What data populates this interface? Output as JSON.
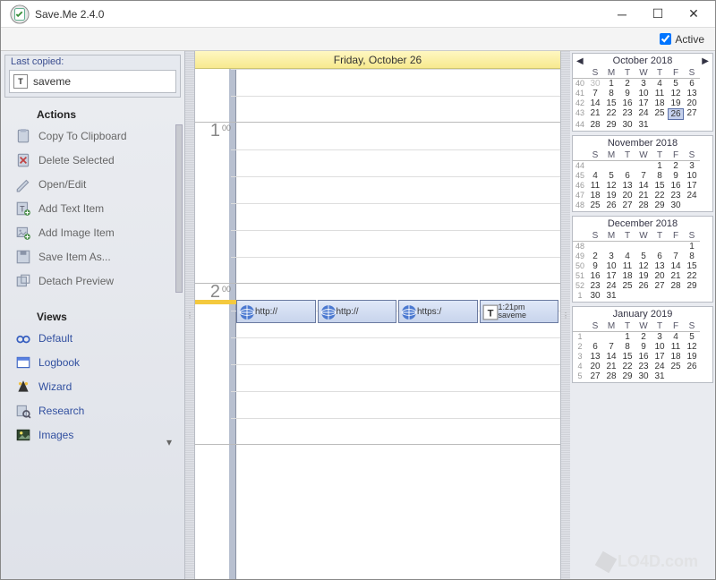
{
  "window": {
    "title": "Save.Me 2.4.0"
  },
  "toolbar": {
    "active_label": "Active",
    "active_checked": true
  },
  "last_copied": {
    "heading": "Last copied:",
    "item_label": "saveme"
  },
  "actions": {
    "heading": "Actions",
    "items": [
      {
        "label": "Copy To Clipboard",
        "icon": "clipboard-icon"
      },
      {
        "label": "Delete Selected",
        "icon": "delete-icon"
      },
      {
        "label": "Open/Edit",
        "icon": "edit-icon"
      },
      {
        "label": "Add Text Item",
        "icon": "text-add-icon"
      },
      {
        "label": "Add Image Item",
        "icon": "image-add-icon"
      },
      {
        "label": "Save Item As...",
        "icon": "save-as-icon"
      },
      {
        "label": "Detach Preview",
        "icon": "detach-icon"
      }
    ]
  },
  "views": {
    "heading": "Views",
    "items": [
      {
        "label": "Default",
        "icon": "glasses-icon"
      },
      {
        "label": "Logbook",
        "icon": "logbook-icon"
      },
      {
        "label": "Wizard",
        "icon": "wizard-icon"
      },
      {
        "label": "Research",
        "icon": "research-icon"
      },
      {
        "label": "Images",
        "icon": "images-icon"
      }
    ]
  },
  "day_view": {
    "header": "Friday, October 26",
    "hours": [
      {
        "label": "",
        "min": ""
      },
      {
        "label": "1",
        "min": "00"
      },
      {
        "label": "2",
        "min": "00"
      }
    ],
    "events": [
      {
        "icon": "globe-icon",
        "text": "http://"
      },
      {
        "icon": "globe-icon",
        "text": "http://"
      },
      {
        "icon": "globe-icon",
        "text": "https:/"
      },
      {
        "icon": "text-icon",
        "text": "1:21pm",
        "note": "saveme"
      }
    ]
  },
  "calendars": [
    {
      "title": "October 2018",
      "nav": true,
      "dow": [
        "S",
        "M",
        "T",
        "W",
        "T",
        "F",
        "S"
      ],
      "weeks": [
        {
          "wn": 40,
          "days": [
            {
              "n": 30,
              "out": true
            },
            {
              "n": 1
            },
            {
              "n": 2
            },
            {
              "n": 3
            },
            {
              "n": 4
            },
            {
              "n": 5
            },
            {
              "n": 6
            }
          ]
        },
        {
          "wn": 41,
          "days": [
            {
              "n": 7
            },
            {
              "n": 8
            },
            {
              "n": 9
            },
            {
              "n": 10
            },
            {
              "n": 11
            },
            {
              "n": 12
            },
            {
              "n": 13
            }
          ]
        },
        {
          "wn": 42,
          "days": [
            {
              "n": 14
            },
            {
              "n": 15
            },
            {
              "n": 16
            },
            {
              "n": 17
            },
            {
              "n": 18
            },
            {
              "n": 19
            },
            {
              "n": 20
            }
          ]
        },
        {
          "wn": 43,
          "days": [
            {
              "n": 21
            },
            {
              "n": 22
            },
            {
              "n": 23
            },
            {
              "n": 24
            },
            {
              "n": 25
            },
            {
              "n": 26,
              "sel": true
            },
            {
              "n": 27
            }
          ]
        },
        {
          "wn": 44,
          "days": [
            {
              "n": 28
            },
            {
              "n": 29
            },
            {
              "n": 30
            },
            {
              "n": 31
            },
            {
              "n": ""
            },
            {
              "n": ""
            },
            {
              "n": ""
            }
          ]
        }
      ]
    },
    {
      "title": "November 2018",
      "dow": [
        "S",
        "M",
        "T",
        "W",
        "T",
        "F",
        "S"
      ],
      "weeks": [
        {
          "wn": 44,
          "days": [
            {
              "n": ""
            },
            {
              "n": ""
            },
            {
              "n": ""
            },
            {
              "n": ""
            },
            {
              "n": 1
            },
            {
              "n": 2
            },
            {
              "n": 3
            }
          ]
        },
        {
          "wn": 45,
          "days": [
            {
              "n": 4
            },
            {
              "n": 5
            },
            {
              "n": 6
            },
            {
              "n": 7
            },
            {
              "n": 8
            },
            {
              "n": 9
            },
            {
              "n": 10
            }
          ]
        },
        {
          "wn": 46,
          "days": [
            {
              "n": 11
            },
            {
              "n": 12
            },
            {
              "n": 13
            },
            {
              "n": 14
            },
            {
              "n": 15
            },
            {
              "n": 16
            },
            {
              "n": 17
            }
          ]
        },
        {
          "wn": 47,
          "days": [
            {
              "n": 18
            },
            {
              "n": 19
            },
            {
              "n": 20
            },
            {
              "n": 21
            },
            {
              "n": 22
            },
            {
              "n": 23
            },
            {
              "n": 24
            }
          ]
        },
        {
          "wn": 48,
          "days": [
            {
              "n": 25
            },
            {
              "n": 26
            },
            {
              "n": 27
            },
            {
              "n": 28
            },
            {
              "n": 29
            },
            {
              "n": 30
            },
            {
              "n": ""
            }
          ]
        }
      ]
    },
    {
      "title": "December 2018",
      "dow": [
        "S",
        "M",
        "T",
        "W",
        "T",
        "F",
        "S"
      ],
      "weeks": [
        {
          "wn": 48,
          "days": [
            {
              "n": ""
            },
            {
              "n": ""
            },
            {
              "n": ""
            },
            {
              "n": ""
            },
            {
              "n": ""
            },
            {
              "n": ""
            },
            {
              "n": 1
            }
          ]
        },
        {
          "wn": 49,
          "days": [
            {
              "n": 2
            },
            {
              "n": 3
            },
            {
              "n": 4
            },
            {
              "n": 5
            },
            {
              "n": 6
            },
            {
              "n": 7
            },
            {
              "n": 8
            }
          ]
        },
        {
          "wn": 50,
          "days": [
            {
              "n": 9
            },
            {
              "n": 10
            },
            {
              "n": 11
            },
            {
              "n": 12
            },
            {
              "n": 13
            },
            {
              "n": 14
            },
            {
              "n": 15
            }
          ]
        },
        {
          "wn": 51,
          "days": [
            {
              "n": 16
            },
            {
              "n": 17
            },
            {
              "n": 18
            },
            {
              "n": 19
            },
            {
              "n": 20
            },
            {
              "n": 21
            },
            {
              "n": 22
            }
          ]
        },
        {
          "wn": 52,
          "days": [
            {
              "n": 23
            },
            {
              "n": 24
            },
            {
              "n": 25
            },
            {
              "n": 26
            },
            {
              "n": 27
            },
            {
              "n": 28
            },
            {
              "n": 29
            }
          ]
        },
        {
          "wn": 1,
          "days": [
            {
              "n": 30
            },
            {
              "n": 31
            },
            {
              "n": ""
            },
            {
              "n": ""
            },
            {
              "n": ""
            },
            {
              "n": ""
            },
            {
              "n": ""
            }
          ]
        }
      ]
    },
    {
      "title": "January 2019",
      "dow": [
        "S",
        "M",
        "T",
        "W",
        "T",
        "F",
        "S"
      ],
      "weeks": [
        {
          "wn": 1,
          "days": [
            {
              "n": ""
            },
            {
              "n": ""
            },
            {
              "n": 1
            },
            {
              "n": 2
            },
            {
              "n": 3
            },
            {
              "n": 4
            },
            {
              "n": 5
            }
          ]
        },
        {
          "wn": 2,
          "days": [
            {
              "n": 6
            },
            {
              "n": 7
            },
            {
              "n": 8
            },
            {
              "n": 9
            },
            {
              "n": 10
            },
            {
              "n": 11
            },
            {
              "n": 12
            }
          ]
        },
        {
          "wn": 3,
          "days": [
            {
              "n": 13
            },
            {
              "n": 14
            },
            {
              "n": 15
            },
            {
              "n": 16
            },
            {
              "n": 17
            },
            {
              "n": 18
            },
            {
              "n": 19
            }
          ]
        },
        {
          "wn": 4,
          "days": [
            {
              "n": 20
            },
            {
              "n": 21
            },
            {
              "n": 22
            },
            {
              "n": 23
            },
            {
              "n": 24
            },
            {
              "n": 25
            },
            {
              "n": 26
            }
          ]
        },
        {
          "wn": 5,
          "days": [
            {
              "n": 27
            },
            {
              "n": 28
            },
            {
              "n": 29
            },
            {
              "n": 30
            },
            {
              "n": 31
            },
            {
              "n": ""
            },
            {
              "n": ""
            }
          ]
        }
      ]
    }
  ],
  "watermark": "LO4D.com"
}
